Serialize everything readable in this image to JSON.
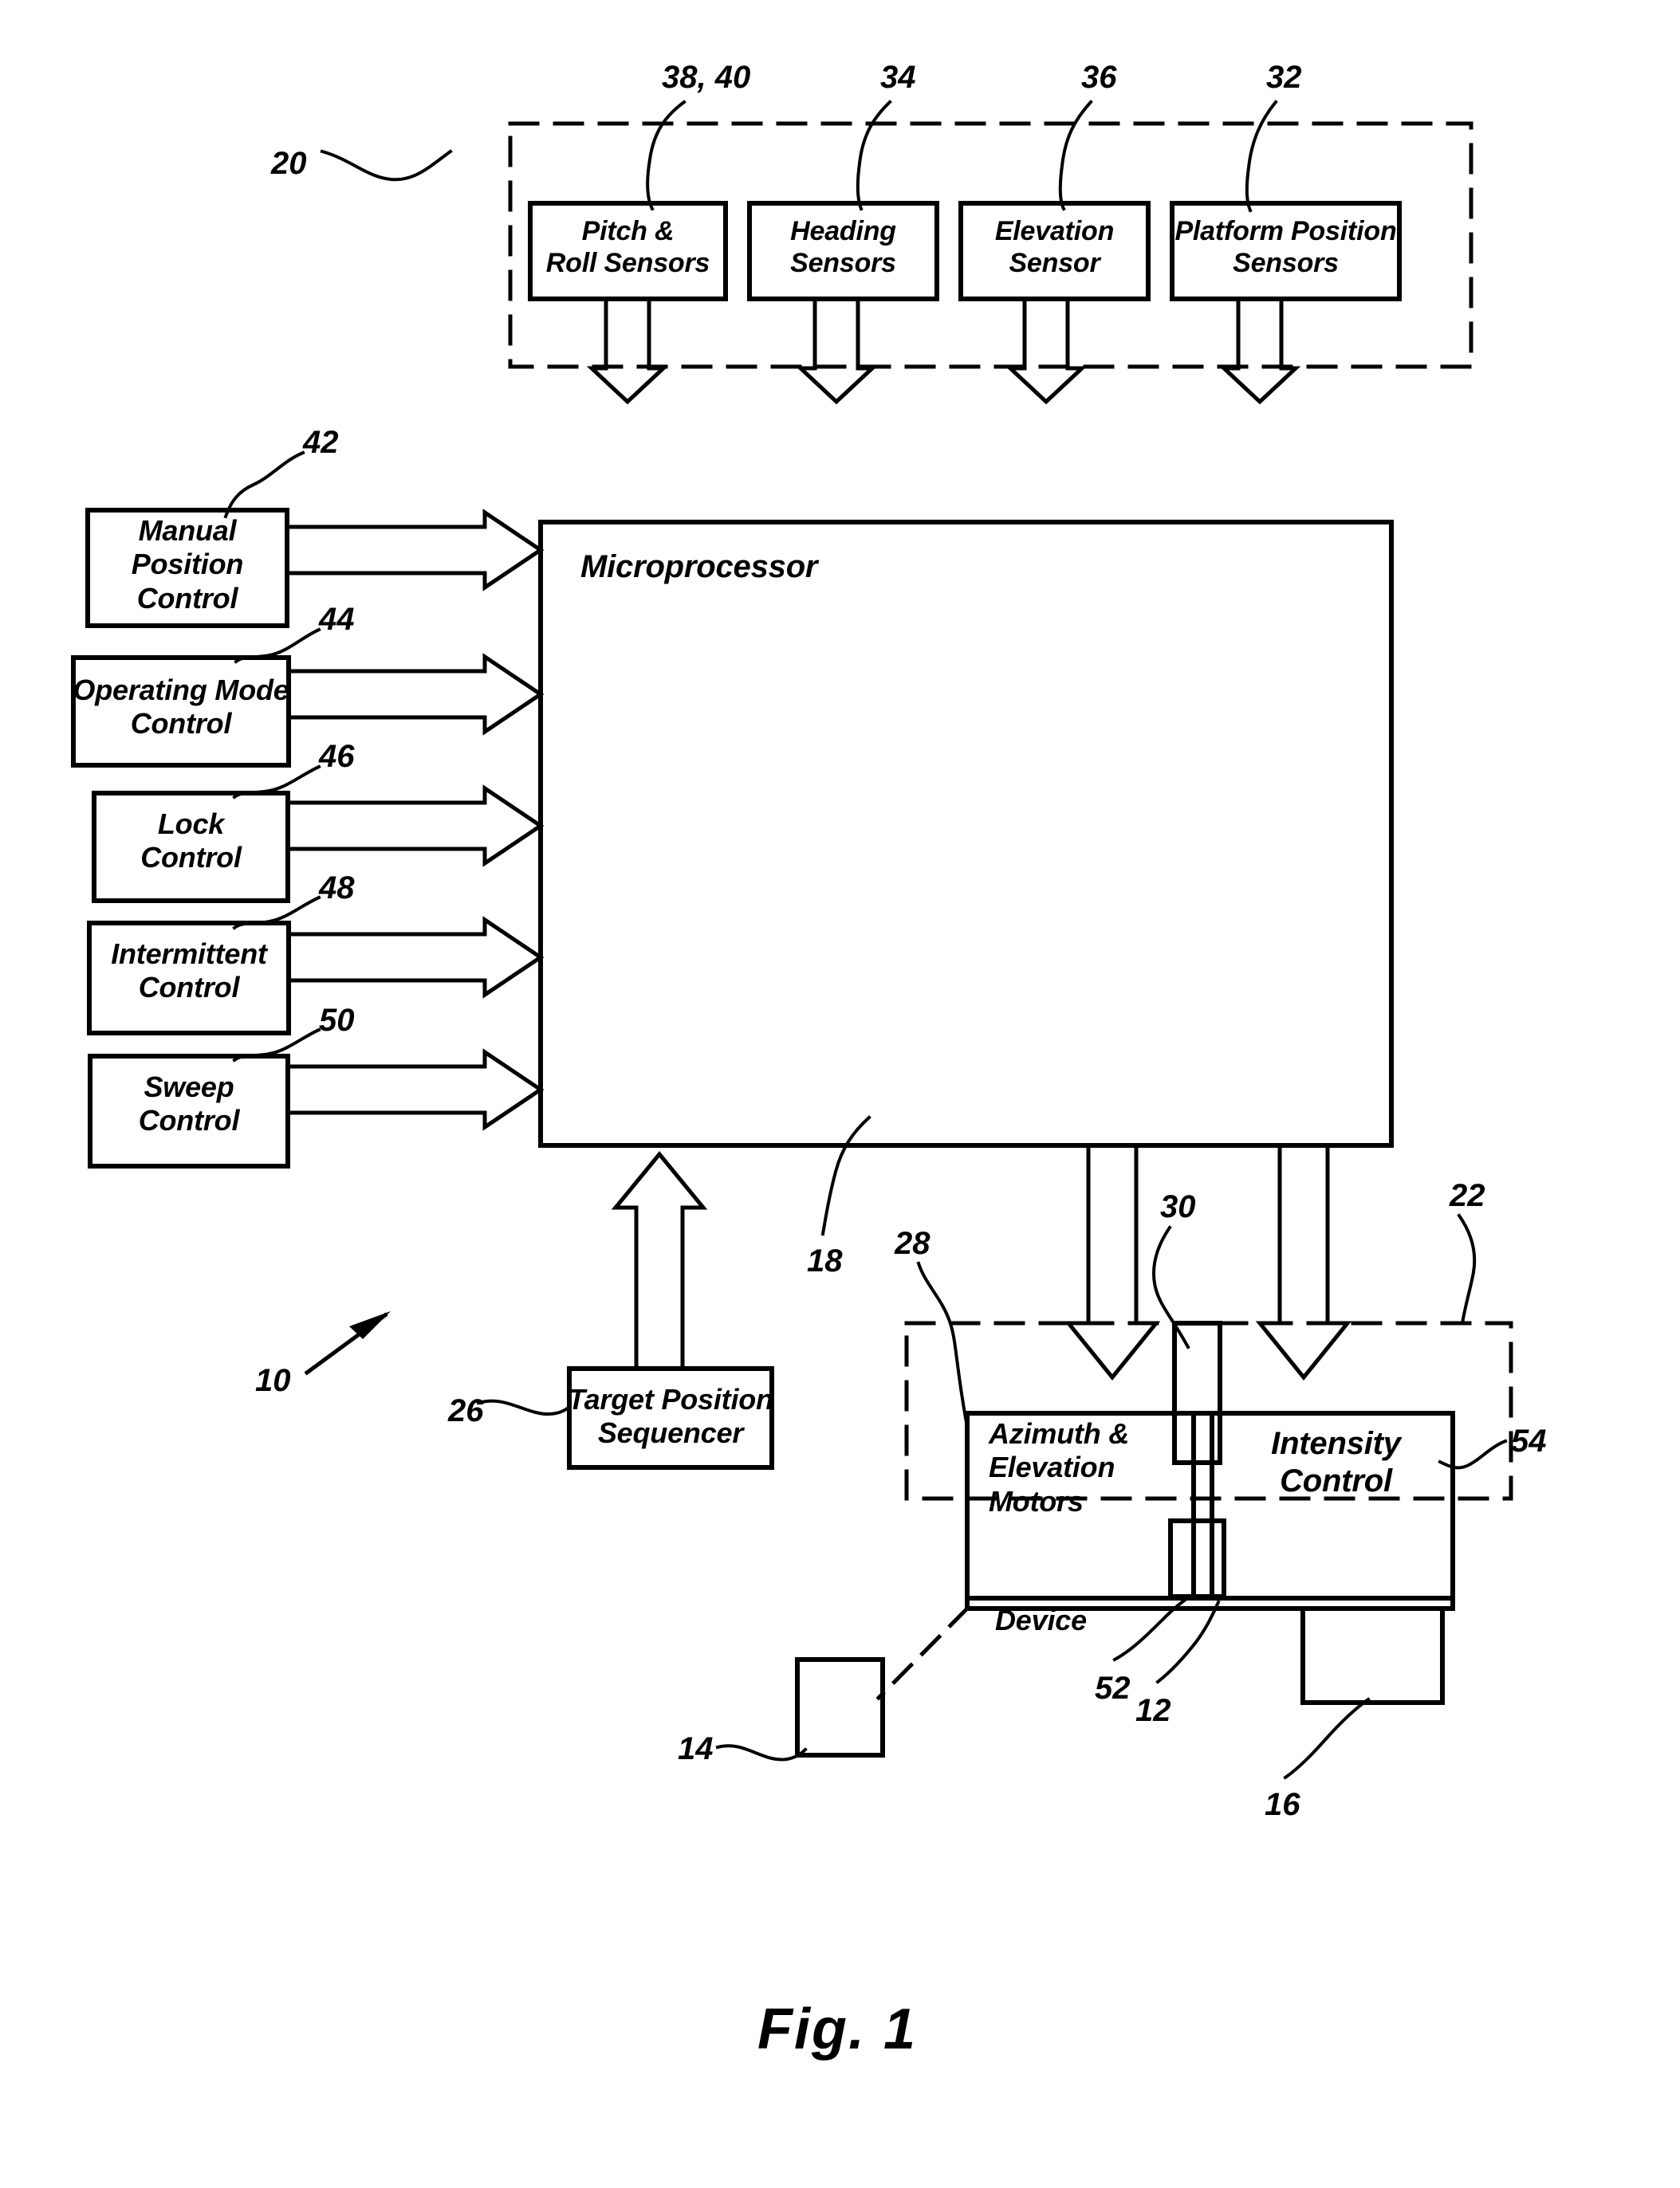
{
  "figure": {
    "caption": "Fig. 1",
    "system_ref": "10"
  },
  "sensor_group": {
    "ref": "20",
    "boxes": [
      {
        "label": "Pitch &\nRoll Sensors",
        "ref": "38, 40"
      },
      {
        "label": "Heading\nSensors",
        "ref": "34"
      },
      {
        "label": "Elevation\nSensor",
        "ref": "36"
      },
      {
        "label": "Platform Position\nSensors",
        "ref": "32"
      }
    ]
  },
  "controls": [
    {
      "label": "Manual\nPosition\nControl",
      "ref": "42"
    },
    {
      "label": "Operating Mode\nControl",
      "ref": "44"
    },
    {
      "label": "Lock\nControl",
      "ref": "46"
    },
    {
      "label": "Intermittent\nControl",
      "ref": "48"
    },
    {
      "label": "Sweep\nControl",
      "ref": "50"
    }
  ],
  "processor": {
    "label": "Microprocessor",
    "ref": "18"
  },
  "sequencer": {
    "label": "Target Position\nSequencer",
    "ref": "26"
  },
  "device_group": {
    "ref": "22",
    "motors": {
      "label": "Azimuth &\nElevation\nMotors",
      "ref": "28"
    },
    "intensity": {
      "label": "Intensity\nControl",
      "ref": "54"
    },
    "device": {
      "label": "Device",
      "ref": "12"
    },
    "lamp_ref": "30",
    "beam_ref": "52",
    "base_ref": "16",
    "target_ref": "14"
  },
  "colors": {
    "line": "#000000",
    "background": "#ffffff"
  }
}
